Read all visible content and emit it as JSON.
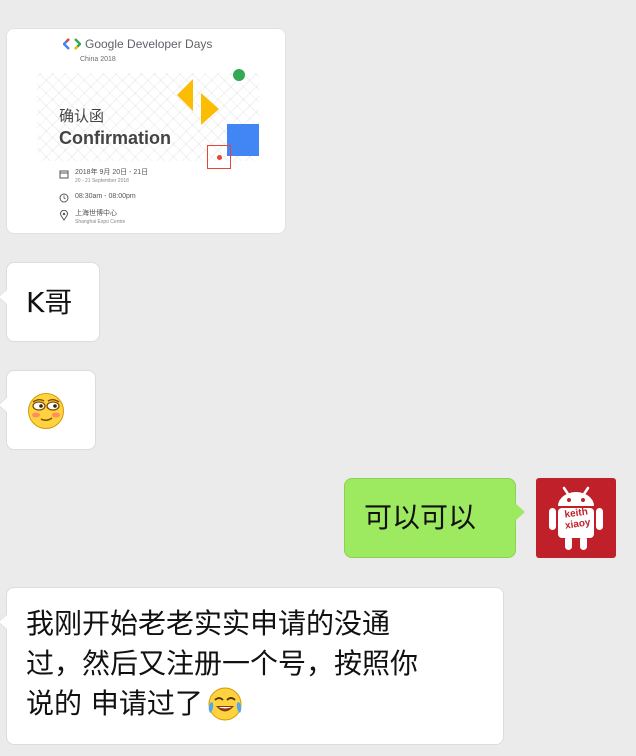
{
  "image_card": {
    "brand": "Google Developer Days",
    "subtitle": "China 2018",
    "title_zh": "确认函",
    "title_en": "Confirmation",
    "date_line": "2018年 9月 20日 - 21日",
    "date_sub": "20 - 21 September 2018",
    "time_line": "08:30am - 08:00pm",
    "place_line": "上海世博中心",
    "place_sub": "Shanghai Expo Centre",
    "colors": {
      "green": "#34a853",
      "blue": "#4285f4",
      "red": "#ea4335",
      "yellow": "#fbbc04"
    }
  },
  "messages": [
    {
      "side": "left",
      "text": "K哥"
    },
    {
      "side": "left",
      "emoji": "smirk-face-emoji"
    },
    {
      "side": "right",
      "text": "可以可以"
    },
    {
      "side": "left",
      "text_lines": [
        "我刚开始老老实实申请的没通",
        "过，然后又注册一个号，按照你",
        "说的 申请过了"
      ],
      "trailing_emoji": "crying-laughing-emoji"
    }
  ],
  "avatar": {
    "name_line1": "keith",
    "name_line2": "xiaoy",
    "icon": "android-robot-icon",
    "background": "#c0202a"
  },
  "colors": {
    "chat_background": "#ebebeb",
    "incoming_bubble": "#ffffff",
    "outgoing_bubble": "#9de95f"
  }
}
